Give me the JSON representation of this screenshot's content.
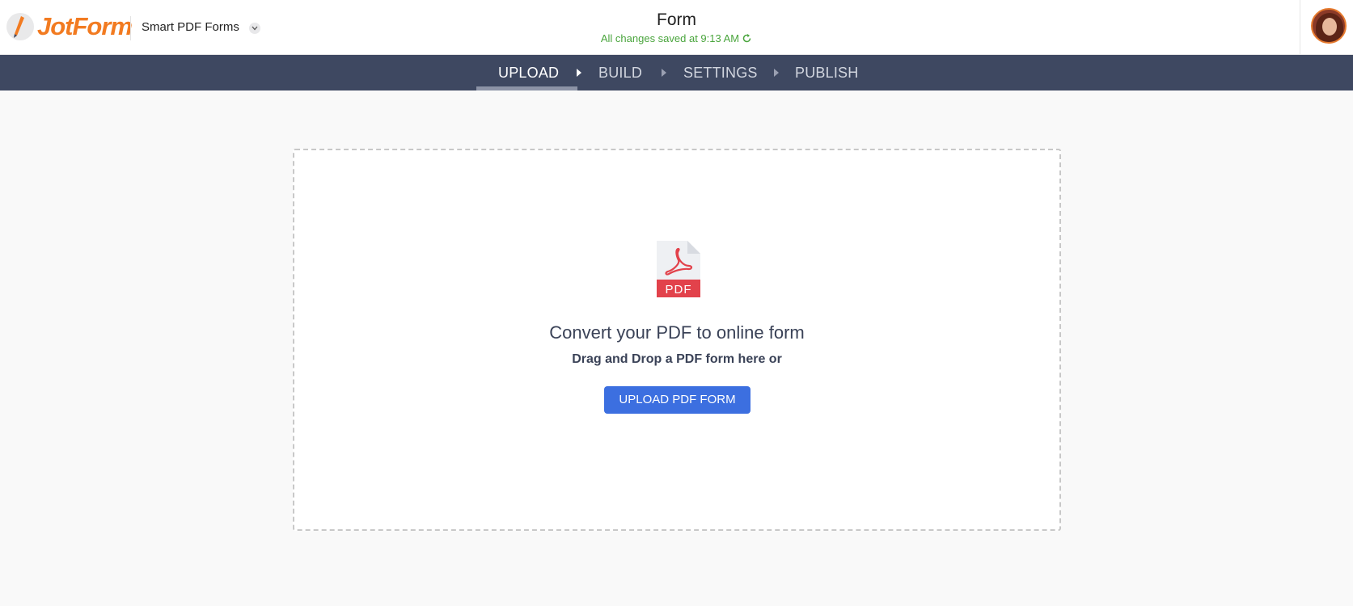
{
  "header": {
    "logo_text": "JotForm",
    "product_name": "Smart PDF Forms",
    "form_title": "Form",
    "save_status": "All changes saved at 9:13 AM"
  },
  "steps": [
    {
      "label": "UPLOAD",
      "active": true
    },
    {
      "label": "BUILD",
      "active": false
    },
    {
      "label": "SETTINGS",
      "active": false
    },
    {
      "label": "PUBLISH",
      "active": false
    }
  ],
  "dropzone": {
    "icon_label": "PDF",
    "title": "Convert your PDF to online form",
    "subtitle": "Drag and Drop a PDF form here or",
    "button_label": "UPLOAD PDF FORM"
  },
  "colors": {
    "brand_orange": "#f27b21",
    "nav_bg": "#3e4861",
    "success_green": "#4aa53d",
    "primary_button": "#3c6fe0",
    "pdf_red": "#e2424b"
  },
  "icons": [
    "jotform-logo-icon",
    "chevron-down-icon",
    "refresh-icon",
    "user-avatar",
    "pdf-file-icon"
  ]
}
